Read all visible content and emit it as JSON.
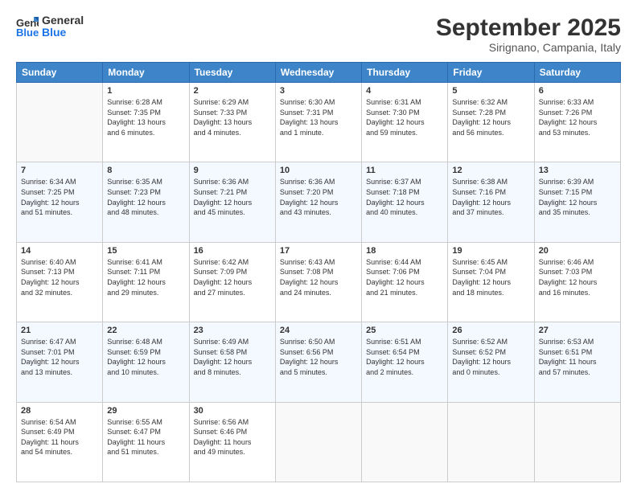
{
  "header": {
    "logo_line1": "General",
    "logo_line2": "Blue",
    "month": "September 2025",
    "location": "Sirignano, Campania, Italy"
  },
  "days_of_week": [
    "Sunday",
    "Monday",
    "Tuesday",
    "Wednesday",
    "Thursday",
    "Friday",
    "Saturday"
  ],
  "weeks": [
    [
      {
        "day": "",
        "text": ""
      },
      {
        "day": "1",
        "text": "Sunrise: 6:28 AM\nSunset: 7:35 PM\nDaylight: 13 hours\nand 6 minutes."
      },
      {
        "day": "2",
        "text": "Sunrise: 6:29 AM\nSunset: 7:33 PM\nDaylight: 13 hours\nand 4 minutes."
      },
      {
        "day": "3",
        "text": "Sunrise: 6:30 AM\nSunset: 7:31 PM\nDaylight: 13 hours\nand 1 minute."
      },
      {
        "day": "4",
        "text": "Sunrise: 6:31 AM\nSunset: 7:30 PM\nDaylight: 12 hours\nand 59 minutes."
      },
      {
        "day": "5",
        "text": "Sunrise: 6:32 AM\nSunset: 7:28 PM\nDaylight: 12 hours\nand 56 minutes."
      },
      {
        "day": "6",
        "text": "Sunrise: 6:33 AM\nSunset: 7:26 PM\nDaylight: 12 hours\nand 53 minutes."
      }
    ],
    [
      {
        "day": "7",
        "text": "Sunrise: 6:34 AM\nSunset: 7:25 PM\nDaylight: 12 hours\nand 51 minutes."
      },
      {
        "day": "8",
        "text": "Sunrise: 6:35 AM\nSunset: 7:23 PM\nDaylight: 12 hours\nand 48 minutes."
      },
      {
        "day": "9",
        "text": "Sunrise: 6:36 AM\nSunset: 7:21 PM\nDaylight: 12 hours\nand 45 minutes."
      },
      {
        "day": "10",
        "text": "Sunrise: 6:36 AM\nSunset: 7:20 PM\nDaylight: 12 hours\nand 43 minutes."
      },
      {
        "day": "11",
        "text": "Sunrise: 6:37 AM\nSunset: 7:18 PM\nDaylight: 12 hours\nand 40 minutes."
      },
      {
        "day": "12",
        "text": "Sunrise: 6:38 AM\nSunset: 7:16 PM\nDaylight: 12 hours\nand 37 minutes."
      },
      {
        "day": "13",
        "text": "Sunrise: 6:39 AM\nSunset: 7:15 PM\nDaylight: 12 hours\nand 35 minutes."
      }
    ],
    [
      {
        "day": "14",
        "text": "Sunrise: 6:40 AM\nSunset: 7:13 PM\nDaylight: 12 hours\nand 32 minutes."
      },
      {
        "day": "15",
        "text": "Sunrise: 6:41 AM\nSunset: 7:11 PM\nDaylight: 12 hours\nand 29 minutes."
      },
      {
        "day": "16",
        "text": "Sunrise: 6:42 AM\nSunset: 7:09 PM\nDaylight: 12 hours\nand 27 minutes."
      },
      {
        "day": "17",
        "text": "Sunrise: 6:43 AM\nSunset: 7:08 PM\nDaylight: 12 hours\nand 24 minutes."
      },
      {
        "day": "18",
        "text": "Sunrise: 6:44 AM\nSunset: 7:06 PM\nDaylight: 12 hours\nand 21 minutes."
      },
      {
        "day": "19",
        "text": "Sunrise: 6:45 AM\nSunset: 7:04 PM\nDaylight: 12 hours\nand 18 minutes."
      },
      {
        "day": "20",
        "text": "Sunrise: 6:46 AM\nSunset: 7:03 PM\nDaylight: 12 hours\nand 16 minutes."
      }
    ],
    [
      {
        "day": "21",
        "text": "Sunrise: 6:47 AM\nSunset: 7:01 PM\nDaylight: 12 hours\nand 13 minutes."
      },
      {
        "day": "22",
        "text": "Sunrise: 6:48 AM\nSunset: 6:59 PM\nDaylight: 12 hours\nand 10 minutes."
      },
      {
        "day": "23",
        "text": "Sunrise: 6:49 AM\nSunset: 6:58 PM\nDaylight: 12 hours\nand 8 minutes."
      },
      {
        "day": "24",
        "text": "Sunrise: 6:50 AM\nSunset: 6:56 PM\nDaylight: 12 hours\nand 5 minutes."
      },
      {
        "day": "25",
        "text": "Sunrise: 6:51 AM\nSunset: 6:54 PM\nDaylight: 12 hours\nand 2 minutes."
      },
      {
        "day": "26",
        "text": "Sunrise: 6:52 AM\nSunset: 6:52 PM\nDaylight: 12 hours\nand 0 minutes."
      },
      {
        "day": "27",
        "text": "Sunrise: 6:53 AM\nSunset: 6:51 PM\nDaylight: 11 hours\nand 57 minutes."
      }
    ],
    [
      {
        "day": "28",
        "text": "Sunrise: 6:54 AM\nSunset: 6:49 PM\nDaylight: 11 hours\nand 54 minutes."
      },
      {
        "day": "29",
        "text": "Sunrise: 6:55 AM\nSunset: 6:47 PM\nDaylight: 11 hours\nand 51 minutes."
      },
      {
        "day": "30",
        "text": "Sunrise: 6:56 AM\nSunset: 6:46 PM\nDaylight: 11 hours\nand 49 minutes."
      },
      {
        "day": "",
        "text": ""
      },
      {
        "day": "",
        "text": ""
      },
      {
        "day": "",
        "text": ""
      },
      {
        "day": "",
        "text": ""
      }
    ]
  ]
}
